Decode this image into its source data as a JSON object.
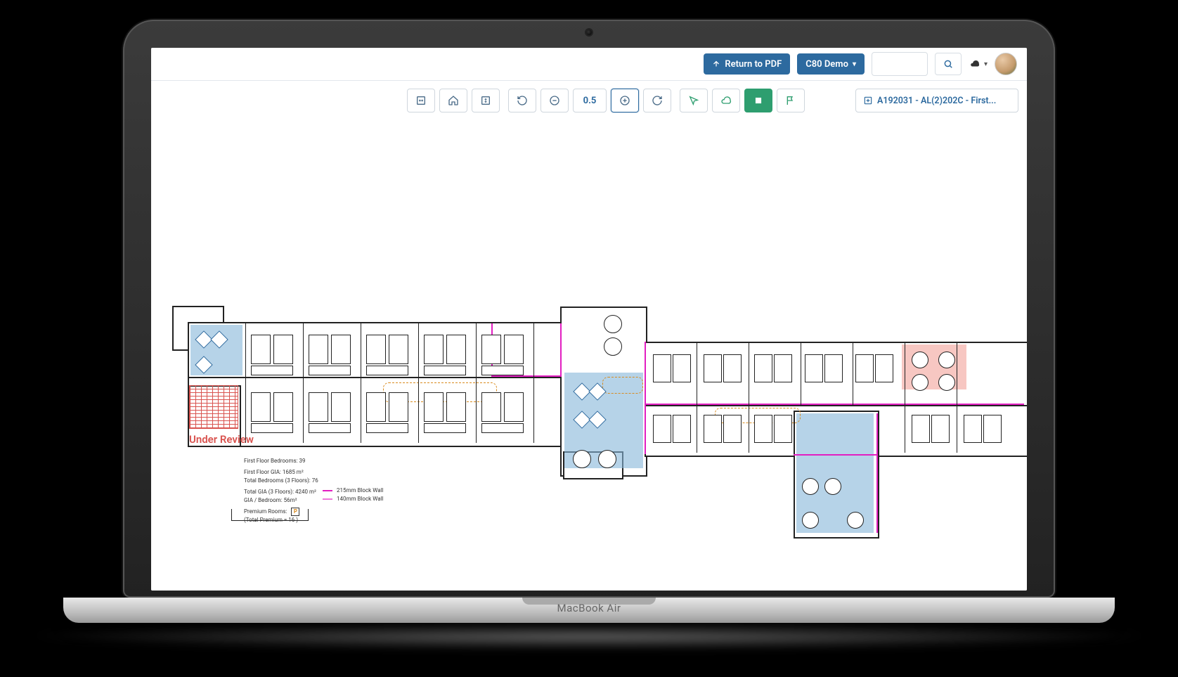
{
  "device": {
    "label": "MacBook Air"
  },
  "topbar": {
    "return_label": "Return to PDF",
    "project_label": "C80 Demo",
    "notification_icon": "cloud"
  },
  "toolbar": {
    "zoom": "0.5",
    "drawing_ref": "A192031 - AL(2)202C - First..."
  },
  "canvas": {
    "annotation_stamp": "Under Review"
  },
  "legend": {
    "line1": "First Floor Bedrooms: 39",
    "line2": "First Floor GIA: 1685 m²",
    "line3": "Total Bedrooms (3 Floors): 76",
    "line4": "Total GIA (3 Floors): 4240 m²",
    "line5": "GIA / Bedroom: 56m²",
    "line6_label": "Premium Rooms:",
    "line7": "(Total Premium = 16 )",
    "wall1": "215mm Block Wall",
    "wall2": "140mm Block Wall"
  },
  "colors": {
    "primary": "#2d6a9f",
    "accent_green": "#2e9e6f",
    "highlight_blue": "#86b6d9",
    "highlight_red": "#f2a29a",
    "service_pink": "#e21ec1",
    "danger": "#d9534f",
    "revision": "#d98b1e"
  }
}
